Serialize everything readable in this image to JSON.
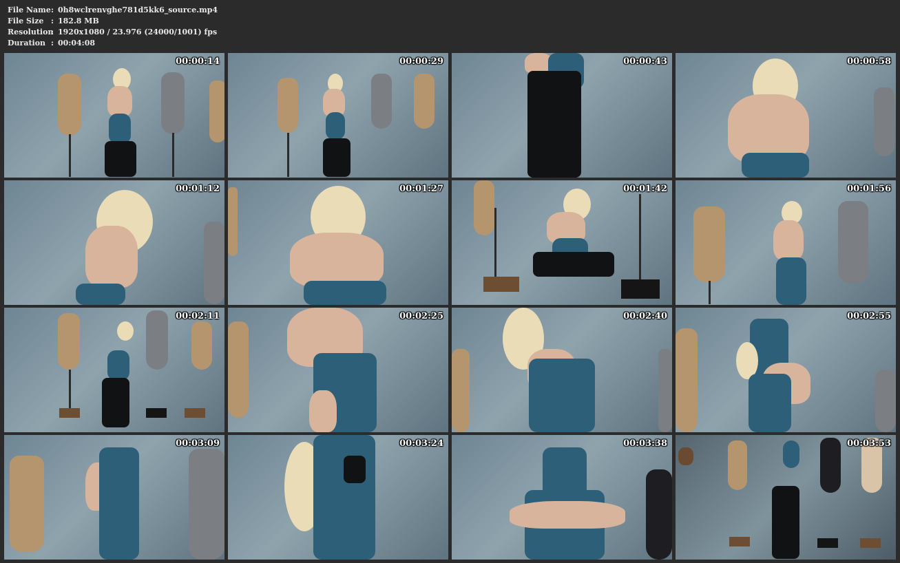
{
  "meta": {
    "rows": [
      {
        "key": "File Name",
        "sep": ":",
        "value": "0h8wclrenvghe781d5kk6_source.mp4"
      },
      {
        "key": "File Size",
        "sep": ":",
        "value": "182.8 MB"
      },
      {
        "key": "Resolution",
        "sep": ":",
        "value": "1920x1080 / 23.976 (24000/1001) fps"
      },
      {
        "key": "Duration",
        "sep": ":",
        "value": "00:04:08"
      }
    ]
  },
  "thumbnails": [
    {
      "time": "00:00:14"
    },
    {
      "time": "00:00:29"
    },
    {
      "time": "00:00:43"
    },
    {
      "time": "00:00:58"
    },
    {
      "time": "00:01:12"
    },
    {
      "time": "00:01:27"
    },
    {
      "time": "00:01:42"
    },
    {
      "time": "00:01:56"
    },
    {
      "time": "00:02:11"
    },
    {
      "time": "00:02:25"
    },
    {
      "time": "00:02:40"
    },
    {
      "time": "00:02:55"
    },
    {
      "time": "00:03:09"
    },
    {
      "time": "00:03:24"
    },
    {
      "time": "00:03:38"
    },
    {
      "time": "00:03:53"
    }
  ],
  "colors": {
    "background": "#2b2b2b",
    "text": "#e8e8e8",
    "timestamp": "#ffffff",
    "latex": "#2d5f78"
  }
}
